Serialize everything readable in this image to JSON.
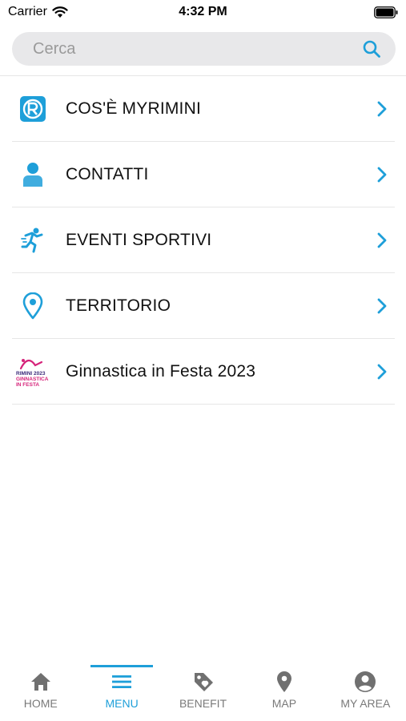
{
  "status_bar": {
    "carrier": "Carrier",
    "time": "4:32 PM"
  },
  "search": {
    "placeholder": "Cerca"
  },
  "menu": {
    "items": [
      {
        "label": "COS'È MYRIMINI",
        "icon": "myrimini-logo-icon"
      },
      {
        "label": "CONTATTI",
        "icon": "person-icon"
      },
      {
        "label": "EVENTI SPORTIVI",
        "icon": "running-figure-icon"
      },
      {
        "label": "TERRITORIO",
        "icon": "location-pin-icon"
      },
      {
        "label": "Ginnastica in Festa 2023",
        "icon": "ginnastica-festa-logo"
      }
    ],
    "ginnastica_logo_text": [
      "RIMINI 2023",
      "GINNASTICA",
      "IN FESTA"
    ]
  },
  "tabs": [
    {
      "label": "HOME",
      "icon": "home-icon",
      "active": false
    },
    {
      "label": "MENU",
      "icon": "hamburger-icon",
      "active": true
    },
    {
      "label": "BENEFIT",
      "icon": "tag-icon",
      "active": false
    },
    {
      "label": "MAP",
      "icon": "map-pin-icon",
      "active": false
    },
    {
      "label": "MY AREA",
      "icon": "account-icon",
      "active": false
    }
  ],
  "colors": {
    "accent": "#1e9fd9",
    "icon_gray": "#707070",
    "logo_pink": "#d6237a"
  }
}
